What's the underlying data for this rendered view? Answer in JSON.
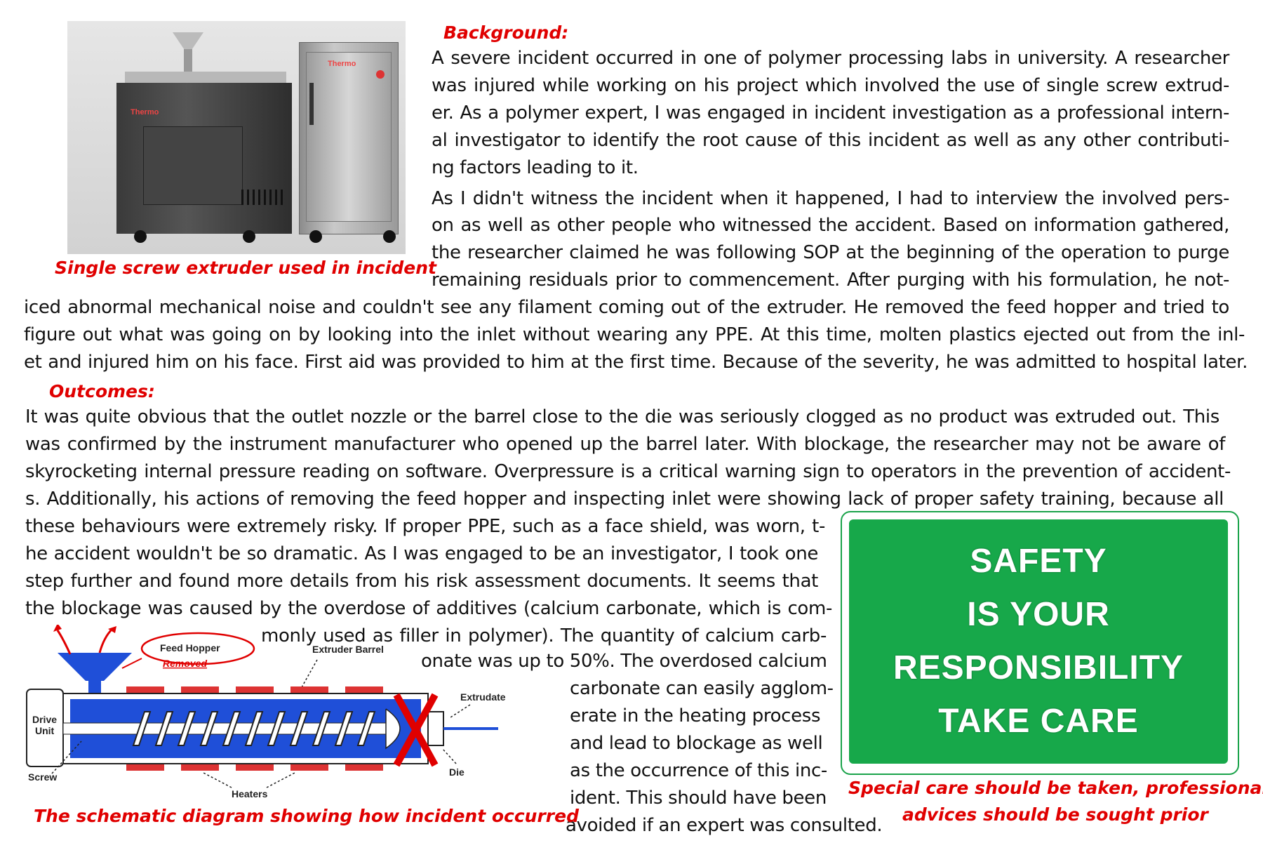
{
  "photo": {
    "caption": "Single screw extruder used in incident",
    "brand_left": "Thermo",
    "brand_right": "Thermo"
  },
  "background": {
    "heading": "Background:",
    "lines": [
      "A severe incident occurred in one of polymer processing labs in university. A researcher",
      "was injured while working on his project which involved the use of single screw extrud-",
      "er. As a polymer expert, I was engaged in incident investigation as a professional intern-",
      "al investigator to identify the root cause of this incident as well as any other contributi-",
      "ng factors leading to it.",
      "As I didn't witness the incident when it happened, I had to interview the involved pers-",
      "on as well as other people who witnessed the accident. Based on information gathered,",
      "the researcher claimed he was following SOP at the beginning of the operation to purge",
      "remaining residuals prior to commencement. After purging with his formulation, he not-",
      "iced abnormal mechanical noise and couldn't see any filament coming out of the extruder. He removed the feed hopper and tried to",
      "figure out what was going on by looking into the inlet without wearing any PPE. At this time, molten plastics ejected out from the inl-",
      "et and injured him on his face. First aid was provided to him at the first time. Because of the severity, he was admitted to hospital later."
    ]
  },
  "outcomes": {
    "heading": "Outcomes:",
    "lines": [
      "It was quite obvious that the outlet nozzle or the barrel close to the die was seriously clogged as no product was extruded out. This",
      "was confirmed by the instrument manufacturer who opened up the barrel later. With blockage, the researcher may not be aware of",
      "skyrocketing internal pressure reading on software. Overpressure is a critical warning sign to operators in the prevention of accident-",
      "s. Additionally, his actions of removing the feed hopper and inspecting inlet were showing lack of proper safety training, because all",
      "these behaviours were extremely risky. If proper PPE, such as a face shield, was worn, t-",
      "he accident wouldn't be so dramatic. As I was engaged to be an investigator, I took one",
      "step further and found more details from his risk assessment documents. It seems that",
      "the blockage was caused by the overdose of additives (calcium carbonate, which is com-",
      "monly used as filler in polymer). The quantity of calcium carb-",
      "onate was up to 50%. The overdosed calcium",
      "carbonate can easily agglom-",
      "erate in the heating process",
      "and lead to blockage as well",
      "as the occurrence of this inc-",
      "ident. This should have been",
      "avoided if an expert was consulted."
    ]
  },
  "sign": {
    "lines": [
      "SAFETY",
      "IS YOUR",
      "RESPONSIBILITY",
      "TAKE CARE"
    ],
    "caption_lines": [
      "Special care should be taken, professional",
      "advices should be sought prior"
    ],
    "color": "#17a84a"
  },
  "diagram": {
    "caption": "The schematic diagram showing how incident occurred",
    "labels": {
      "feed_hopper": "Feed Hopper",
      "removed": "Removed",
      "extruder_barrel": "Extruder Barrel",
      "extrudate": "Extrudate",
      "drive_unit_1": "Drive",
      "drive_unit_2": "Unit",
      "screw": "Screw",
      "heaters": "Heaters",
      "die": "Die"
    }
  },
  "colors": {
    "accent_red": "#e00000",
    "sign_green": "#17a84a",
    "flow_blue": "#1f4fd8"
  }
}
